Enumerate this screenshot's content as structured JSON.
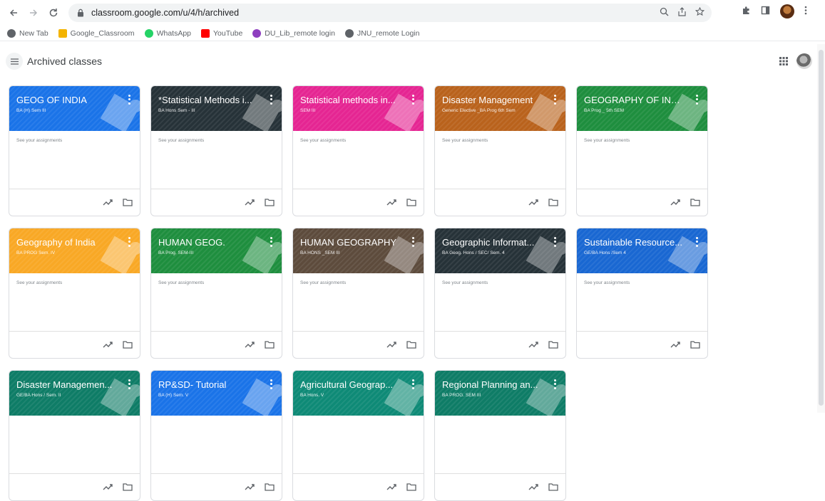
{
  "browser": {
    "url": "classroom.google.com/u/4/h/archived",
    "bookmarks": [
      {
        "label": "New Tab",
        "color": "#5f6368"
      },
      {
        "label": "Google_Classroom",
        "color": "#f4b400"
      },
      {
        "label": "WhatsApp",
        "color": "#25d366"
      },
      {
        "label": "YouTube",
        "color": "#ff0000"
      },
      {
        "label": "DU_Lib_remote login",
        "color": "#8e3fbf"
      },
      {
        "label": "JNU_remote Login",
        "color": "#5f6368"
      }
    ]
  },
  "header": {
    "title": "Archived classes"
  },
  "classes": [
    {
      "title": "GEOG OF INDIA",
      "subtitle": "BA (H) Sem III",
      "color": "#1a73e8",
      "body": "See your assignments"
    },
    {
      "title": "*Statistical Methods i...",
      "subtitle": "BA Hons Sem - III",
      "color": "#263238",
      "body": "See your assignments"
    },
    {
      "title": "Statistical methods in...",
      "subtitle": "SEM III",
      "color": "#e52592",
      "body": "See your assignments"
    },
    {
      "title": "Disaster Management",
      "subtitle": "Generic Elective _BA Prog 6th Sem",
      "color": "#b9621c",
      "body": "See your assignments"
    },
    {
      "title": "GEOGRAPHY OF IND...",
      "subtitle": "BA Prog _ 5th SEM",
      "color": "#1e8e3e",
      "body": "See your assignments"
    },
    {
      "title": "Geography of India",
      "subtitle": "BA PROG Sem. IV",
      "color": "#f9a825",
      "body": "See your assignments"
    },
    {
      "title": "HUMAN GEOG.",
      "subtitle": "BA Prog. SEM-III",
      "color": "#1e8e3e",
      "body": "See your assignments"
    },
    {
      "title": "HUMAN GEOGRAPHY",
      "subtitle": "BA HONS _SEM III",
      "color": "#5d4b3c",
      "body": "See your assignments"
    },
    {
      "title": "Geographic Informat...",
      "subtitle": "BA Geog. Hons / SEC/ Sem. 4",
      "color": "#263238",
      "body": "See your assignments"
    },
    {
      "title": "Sustainable Resource...",
      "subtitle": "GE/BA Hons /Sem 4",
      "color": "#1967d2",
      "body": "See your assignments"
    },
    {
      "title": "Disaster Managemen...",
      "subtitle": "GE/BA Hons / Sem. II",
      "color": "#0e7c66",
      "body": ""
    },
    {
      "title": "RP&SD- Tutorial",
      "subtitle": "BA (H) Sem. V",
      "color": "#1a73e8",
      "body": ""
    },
    {
      "title": "Agricultural Geograp...",
      "subtitle": "BA Hons. V",
      "color": "#0e8a76",
      "body": ""
    },
    {
      "title": "Regional Planning an...",
      "subtitle": "BA PROG. SEM III",
      "color": "#0e7c66",
      "body": ""
    }
  ]
}
